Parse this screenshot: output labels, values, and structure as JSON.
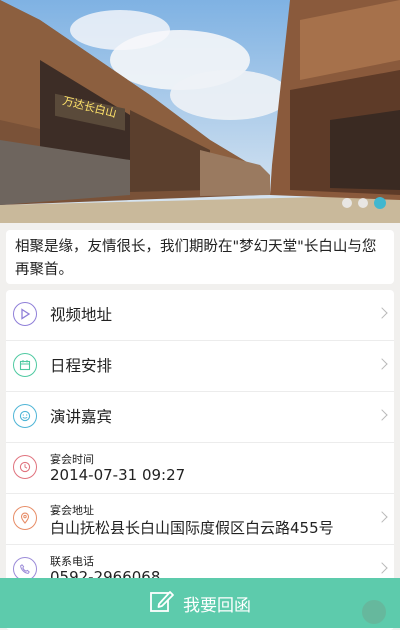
{
  "hero": {
    "sign_text": "万达长白山",
    "slides_count": 3,
    "active_slide": 3
  },
  "intro": {
    "text": "相聚是缘，友情很长，我们期盼在\"梦幻天堂\"长白山与您再聚首。"
  },
  "items": {
    "video": {
      "title": "视频地址",
      "icon": "play-icon",
      "color": "#8f7fd8"
    },
    "schedule": {
      "title": "日程安排",
      "icon": "calendar-icon",
      "color": "#4fc9a1"
    },
    "speakers": {
      "title": "演讲嘉宾",
      "icon": "smile-icon",
      "color": "#4fb5d6"
    },
    "time": {
      "label": "宴会时间",
      "value": "2014-07-31 09:27",
      "icon": "clock-icon",
      "color": "#e0737e"
    },
    "address": {
      "label": "宴会地址",
      "value": "白山抚松县长白山国际度假区白云路455号",
      "icon": "location-pin-icon",
      "color": "#e78d67"
    },
    "phone": {
      "label": "联系电话",
      "value": "0592-2966068",
      "icon": "phone-icon",
      "color": "#9b8bd8"
    }
  },
  "cta": {
    "label": "我要回函",
    "icon": "edit-icon",
    "color": "#5dcbac"
  }
}
